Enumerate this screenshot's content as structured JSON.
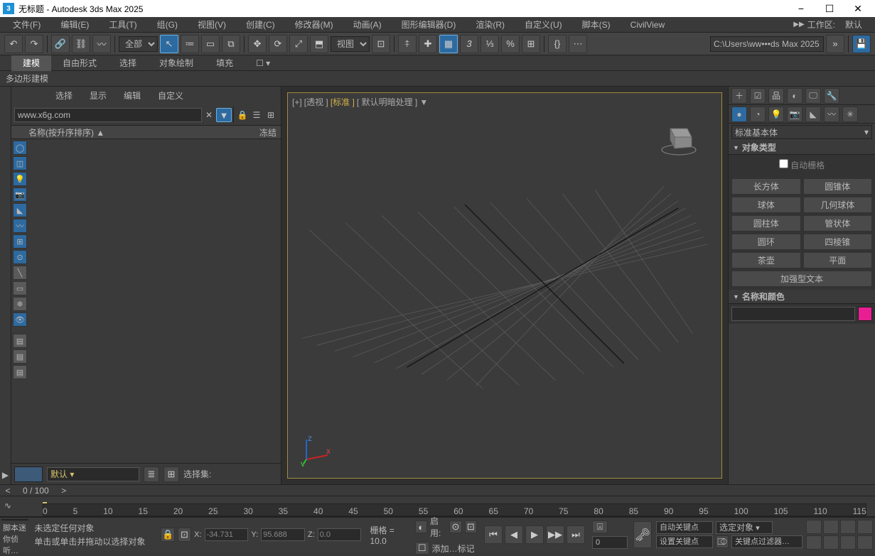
{
  "window": {
    "title": "无标题 - Autodesk 3ds Max 2025",
    "min": "−",
    "max": "☐",
    "close": "✕"
  },
  "menu": {
    "items": [
      "文件(F)",
      "编辑(E)",
      "工具(T)",
      "组(G)",
      "视图(V)",
      "创建(C)",
      "修改器(M)",
      "动画(A)",
      "图形编辑器(D)",
      "渲染(R)",
      "自定义(U)",
      "脚本(S)",
      "CivilView"
    ],
    "workspace_lbl": "工作区:",
    "workspace": "默认"
  },
  "toolbar": {
    "sel_scope": "全部",
    "view_mode": "视图",
    "path": "C:\\Users\\ww•••ds Max 2025"
  },
  "ribbon": {
    "tabs": [
      "建模",
      "自由形式",
      "选择",
      "对象绘制",
      "填充"
    ],
    "sub": "多边形建模"
  },
  "scene": {
    "tabs": [
      "选择",
      "显示",
      "编辑",
      "自定义"
    ],
    "search": "www.x6g.com",
    "col_name": "名称(按升序排序)",
    "col_sort": "▲",
    "col_freeze": "冻结",
    "layer": "默认",
    "selset": "选择集:"
  },
  "viewport": {
    "tags": [
      "[+]",
      "[透视 ]",
      "[标准 ]",
      "[ 默认明暗处理 ]"
    ]
  },
  "create": {
    "dd": "标准基本体",
    "roll1": "对象类型",
    "autogrid": "自动栅格",
    "btns": [
      [
        "长方体",
        "圆锥体"
      ],
      [
        "球体",
        "几何球体"
      ],
      [
        "圆柱体",
        "管状体"
      ],
      [
        "圆环",
        "四棱锥"
      ],
      [
        "茶壶",
        "平面"
      ]
    ],
    "wide": "加强型文本",
    "roll2": "名称和颜色"
  },
  "time": {
    "label": "0 / 100",
    "ticks": [
      "0",
      "5",
      "10",
      "15",
      "20",
      "25",
      "30",
      "35",
      "40",
      "45",
      "50",
      "55",
      "60",
      "65",
      "70",
      "75",
      "80",
      "85",
      "90",
      "95",
      "100",
      "105",
      "110",
      "115"
    ]
  },
  "status": {
    "listener": "脚本迷你侦听…",
    "msg1": "未选定任何对象",
    "msg2": "单击或单击并拖动以选择对象",
    "x": "-34.731",
    "y": "95.688",
    "z": "0.0",
    "grid": "栅格 = 10.0",
    "enable": "启用:",
    "addtag": "添加…标记",
    "autokey": "自动关键点",
    "setkey": "设置关键点",
    "selobj": "选定对象",
    "keyfilter": "关键点过滤器…",
    "frame": "0"
  }
}
